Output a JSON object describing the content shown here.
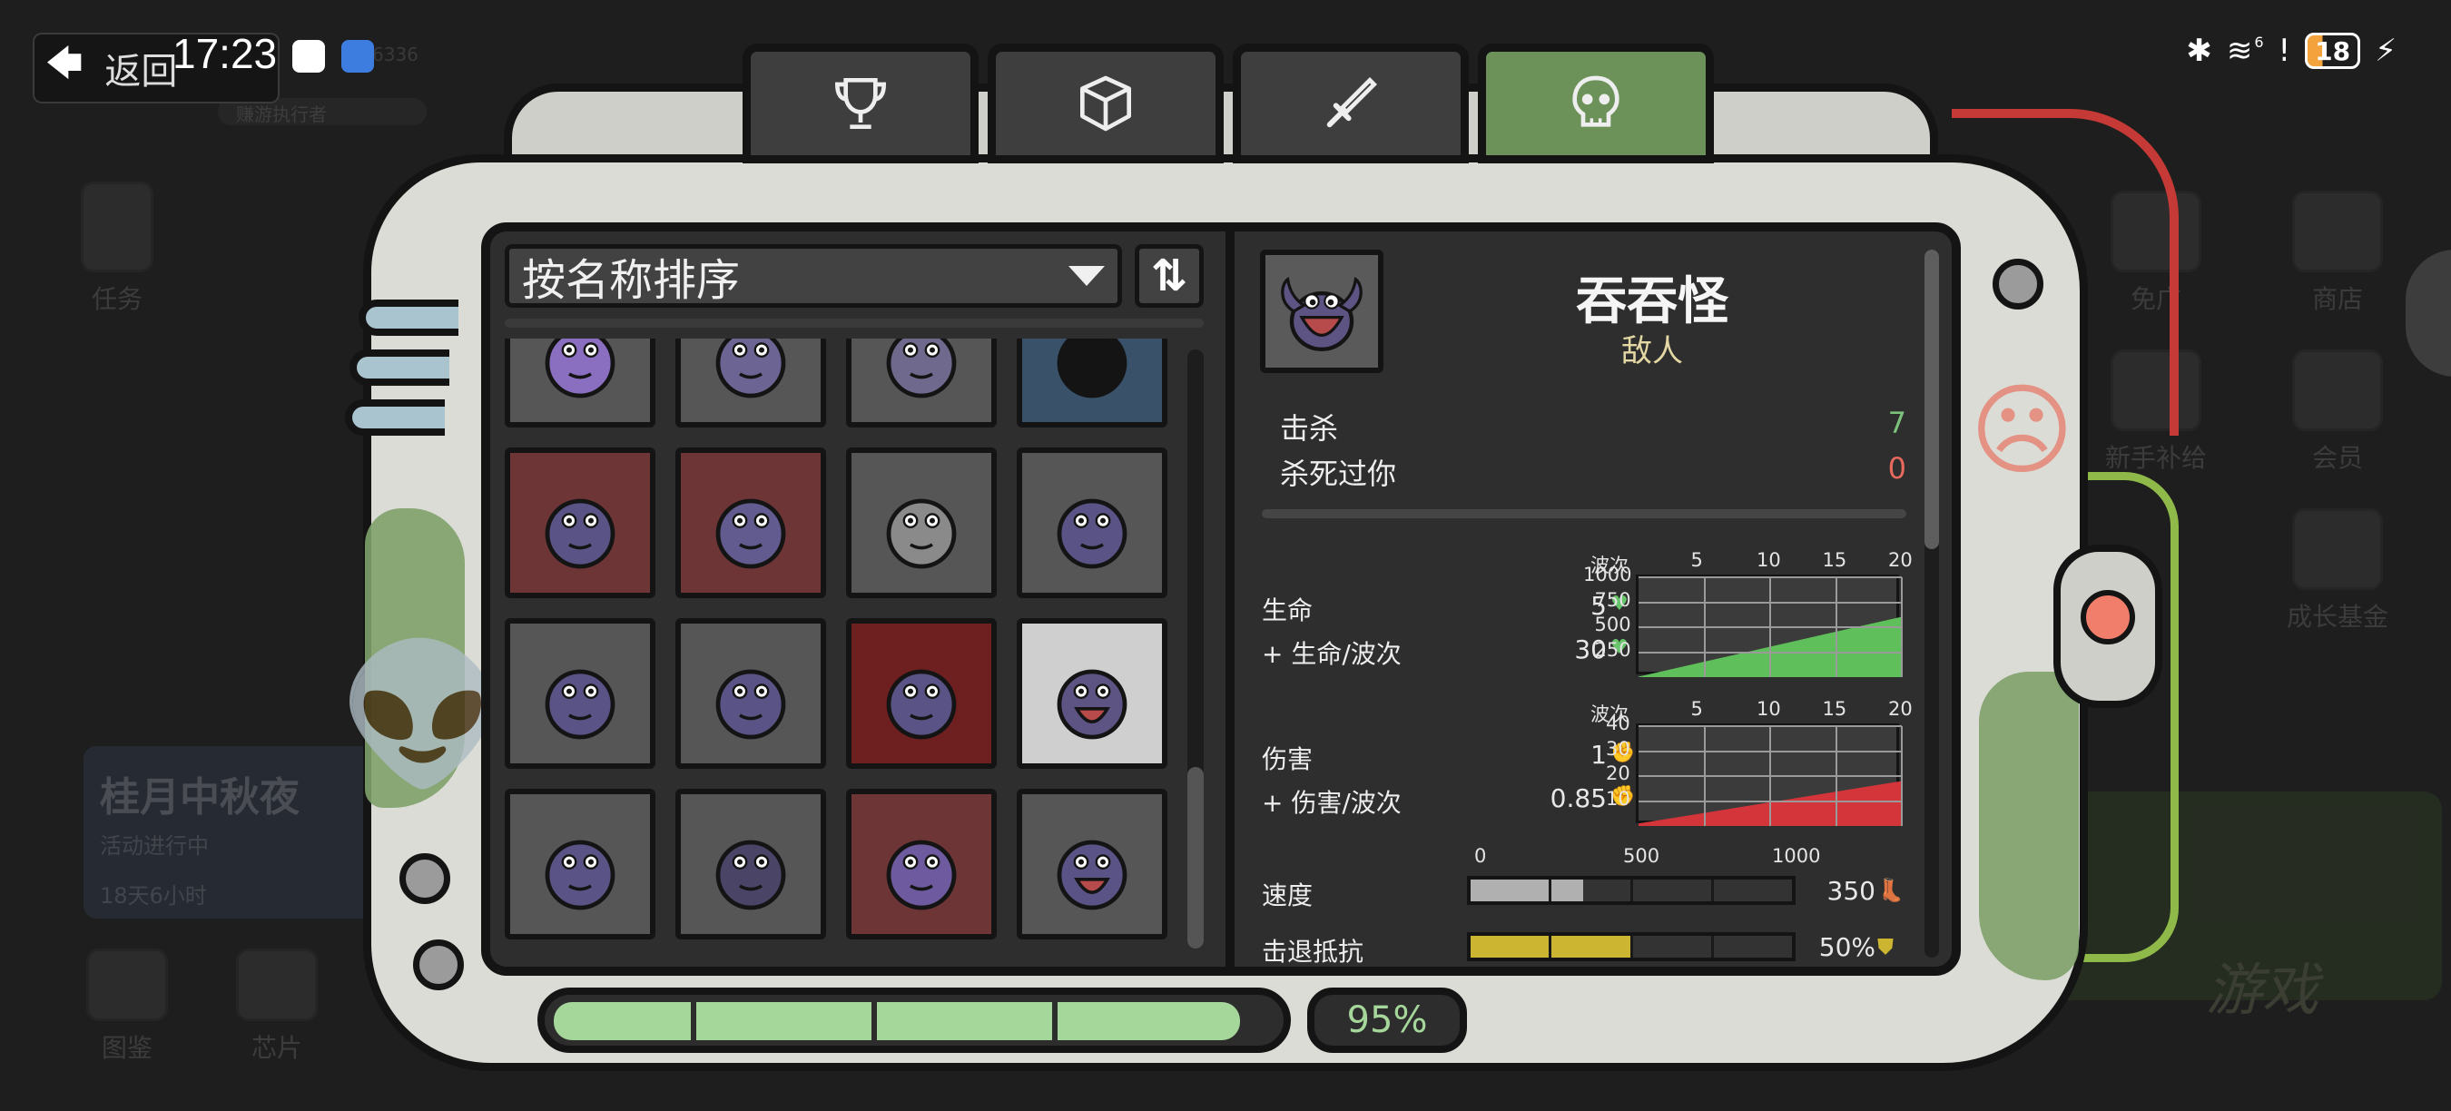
{
  "status_bar": {
    "time": "17:23",
    "battery": "18",
    "signal": "6"
  },
  "back_button": {
    "label": "返回"
  },
  "background": {
    "id_text": "6336",
    "pill_text": "赚游执行者",
    "left_tasks": "任务",
    "left_bottom": [
      "图鉴",
      "芯片"
    ],
    "event_title": "桂月中秋夜",
    "event_status": "活动进行中",
    "event_timer": "18天6小时",
    "right_items": [
      "免广",
      "商店",
      "新手补给",
      "会员",
      "成长基金"
    ],
    "game_text": "游戏"
  },
  "tabs": [
    {
      "name": "trophy",
      "active": false
    },
    {
      "name": "box",
      "active": false
    },
    {
      "name": "sword",
      "active": false
    },
    {
      "name": "skull",
      "active": true
    }
  ],
  "sort": {
    "label": "按名称排序",
    "order_symbol": "⇅"
  },
  "grid": {
    "cells": [
      {
        "bg": "normal",
        "monster": "purple-squid"
      },
      {
        "bg": "normal",
        "monster": "bubble-blob"
      },
      {
        "bg": "normal",
        "monster": "eye-blob"
      },
      {
        "bg": "blue",
        "monster": "silhouette"
      },
      {
        "bg": "red",
        "monster": "spotted-blob"
      },
      {
        "bg": "red",
        "monster": "chef-blob"
      },
      {
        "bg": "normal",
        "monster": "bandage-blob"
      },
      {
        "bg": "normal",
        "monster": "horned-slug"
      },
      {
        "bg": "normal",
        "monster": "round-blob"
      },
      {
        "bg": "normal",
        "monster": "drool-blob"
      },
      {
        "bg": "darkred",
        "monster": "antenna-blob"
      },
      {
        "bg": "white",
        "monster": "gobbler",
        "selected": true
      },
      {
        "bg": "normal",
        "monster": "toxic-blob"
      },
      {
        "bg": "normal",
        "monster": "helmet-blob"
      },
      {
        "bg": "red",
        "monster": "fuzzy-blob"
      },
      {
        "bg": "normal",
        "monster": "mouth-worm"
      }
    ]
  },
  "detail": {
    "name": "吞吞怪",
    "type": "敌人",
    "kills_label": "击杀",
    "kills_value": "7",
    "killed_you_label": "杀死过你",
    "killed_you_value": "0",
    "hp_label": "生命",
    "hp_value": "5",
    "hp_per_wave_label": "+ 生命/波次",
    "hp_per_wave_value": "30",
    "dmg_label": "伤害",
    "dmg_value": "1",
    "dmg_per_wave_label": "+ 伤害/波次",
    "dmg_per_wave_value": "0.85",
    "speed_label": "速度",
    "speed_value": "350",
    "knockback_label": "击退抵抗",
    "knockback_value": "50%",
    "speed_ticks": [
      "0",
      "500",
      "1000"
    ]
  },
  "chart_data": [
    {
      "type": "area",
      "x_title": "波次",
      "x_ticks": [
        "5",
        "10",
        "15",
        "20"
      ],
      "y_ticks": [
        "1000",
        "750",
        "500",
        "250"
      ],
      "xlim": [
        0,
        20
      ],
      "ylim": [
        0,
        1000
      ],
      "x": [
        0,
        20
      ],
      "y": [
        5,
        605
      ],
      "color": "#5fbf5a",
      "grid": true
    },
    {
      "type": "area",
      "x_title": "波次",
      "x_ticks": [
        "5",
        "10",
        "15",
        "20"
      ],
      "y_ticks": [
        "40",
        "30",
        "20",
        "10"
      ],
      "xlim": [
        0,
        20
      ],
      "ylim": [
        0,
        40
      ],
      "x": [
        0,
        20
      ],
      "y": [
        1,
        18
      ],
      "color": "#d4353a",
      "grid": true
    }
  ],
  "bars": {
    "speed_fraction": 0.35,
    "knockback_fraction": 0.5,
    "speed_color": "#b0b0b0",
    "knockback_color": "#cbb531"
  },
  "progress": {
    "fraction": 0.95,
    "percent_label": "95%"
  },
  "colors": {
    "accent_green": "#6c925a",
    "progress_green": "#a5d79b",
    "kill_green": "#7bc27b",
    "death_red": "#e86a5e"
  }
}
